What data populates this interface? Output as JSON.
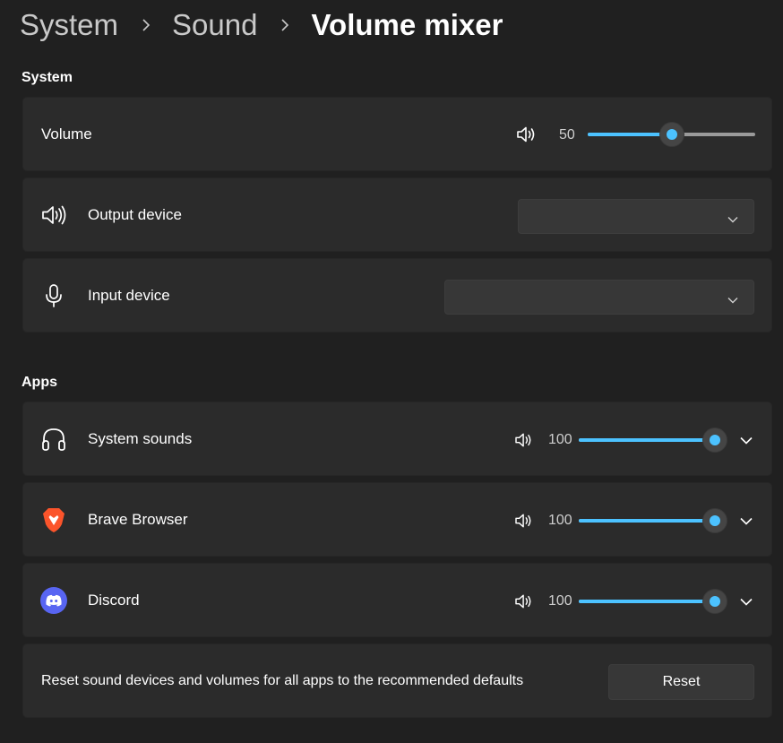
{
  "breadcrumb": {
    "items": [
      "System",
      "Sound",
      "Volume mixer"
    ]
  },
  "system_section": {
    "title": "System",
    "volume": {
      "label": "Volume",
      "value": "50",
      "level": 0.5,
      "icon": "speaker-icon"
    },
    "output_device": {
      "label": "Output device",
      "selected": "",
      "icon": "speaker-icon"
    },
    "input_device": {
      "label": "Input device",
      "selected": "",
      "icon": "microphone-icon"
    }
  },
  "apps_section": {
    "title": "Apps",
    "apps": [
      {
        "label": "System sounds",
        "value": "100",
        "level": 1.0,
        "icon": "headphones-icon"
      },
      {
        "label": "Brave Browser",
        "value": "100",
        "level": 1.0,
        "icon": "brave-icon"
      },
      {
        "label": "Discord",
        "value": "100",
        "level": 1.0,
        "icon": "discord-icon"
      }
    ]
  },
  "reset": {
    "label": "Reset sound devices and volumes for all apps to the recommended defaults",
    "button_label": "Reset"
  },
  "colors": {
    "accent": "#4cc2ff",
    "background": "#202020",
    "card": "#2b2b2b"
  }
}
